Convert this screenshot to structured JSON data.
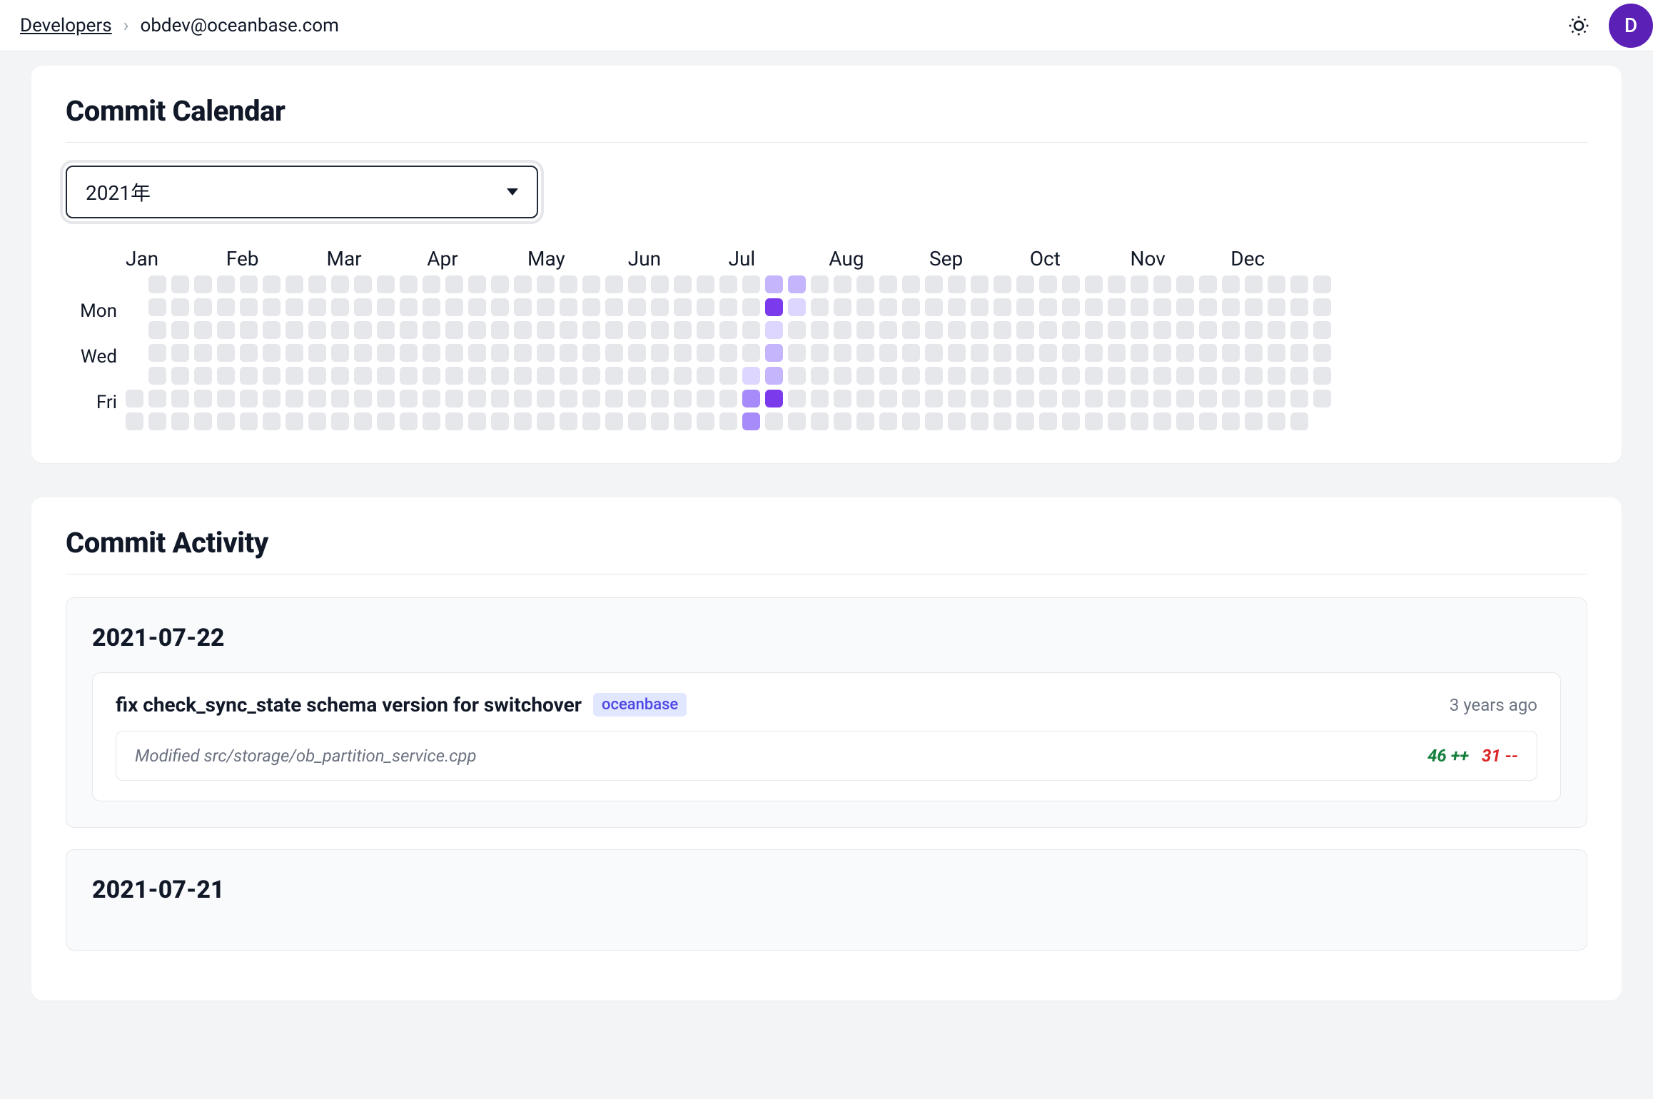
{
  "breadcrumb": {
    "root": "Developers",
    "current": "obdev@oceanbase.com"
  },
  "avatar_initial": "D",
  "calendar": {
    "title": "Commit Calendar",
    "year_label": "2021年",
    "months": [
      "Jan",
      "Feb",
      "Mar",
      "Apr",
      "May",
      "Jun",
      "Jul",
      "Aug",
      "Sep",
      "Oct",
      "Nov",
      "Dec"
    ],
    "day_labels": [
      "",
      "Mon",
      "",
      "Wed",
      "",
      "Fri",
      ""
    ],
    "total_weeks": 53,
    "blanks_start": 5,
    "blanks_end": 1,
    "contributions": {
      "27": {
        "4": 1,
        "5": 3,
        "6": 3
      },
      "28": {
        "0": 2,
        "1": 4,
        "2": 1,
        "3": 2,
        "4": 2,
        "5": 4
      },
      "29": {
        "0": 2,
        "1": 1
      }
    }
  },
  "activity": {
    "title": "Commit Activity",
    "days": [
      {
        "date": "2021-07-22",
        "commits": [
          {
            "title": "fix check_sync_state schema version for switchover",
            "repo": "oceanbase",
            "ago": "3 years ago",
            "files": [
              {
                "label": "Modified src/storage/ob_partition_service.cpp",
                "add": "46 ++",
                "del": "31 --"
              }
            ]
          }
        ]
      },
      {
        "date": "2021-07-21",
        "commits": []
      }
    ]
  }
}
